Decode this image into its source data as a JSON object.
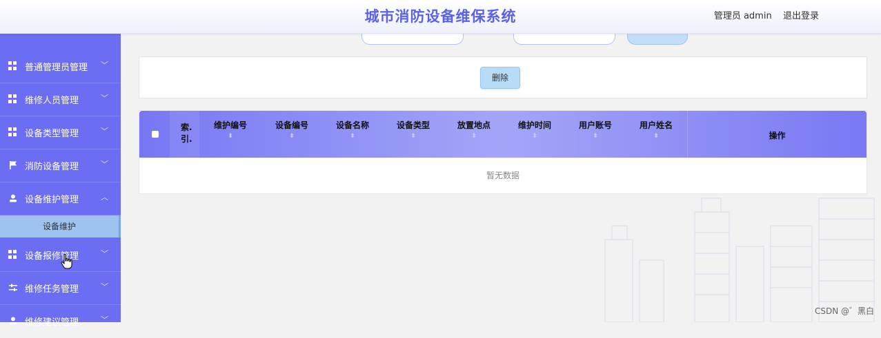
{
  "header": {
    "title": "城市消防设备维保系统",
    "admin_text": "管理员 admin",
    "logout_label": "退出登录"
  },
  "sidebar": {
    "items": [
      {
        "label": "普通管理员管理",
        "icon": "grid-icon",
        "chevron": "﹀"
      },
      {
        "label": "维修人员管理",
        "icon": "grid-icon",
        "chevron": "﹀"
      },
      {
        "label": "设备类型管理",
        "icon": "grid-icon",
        "chevron": "﹀"
      },
      {
        "label": "消防设备管理",
        "icon": "flag-icon",
        "chevron": "﹀"
      },
      {
        "label": "设备维护管理",
        "icon": "user-icon",
        "chevron": "︿"
      },
      {
        "label": "设备报修管理",
        "icon": "grid-icon",
        "chevron": "﹀"
      },
      {
        "label": "维修任务管理",
        "icon": "sliders-icon",
        "chevron": "﹀"
      },
      {
        "label": "维修建议管理",
        "icon": "user-icon",
        "chevron": "﹀"
      }
    ],
    "sub_item": "设备维护"
  },
  "toolbar": {
    "delete_label": "删除"
  },
  "table": {
    "index_header": "索. 引.",
    "columns": [
      "维护编号",
      "设备编号",
      "设备名称",
      "设备类型",
      "放置地点",
      "维护时间",
      "用户账号",
      "用户姓名"
    ],
    "action_header": "操作",
    "sort_glyph": "⬍",
    "empty_text": "暂无数据"
  },
  "watermark": "CSDN @゛黑白"
}
